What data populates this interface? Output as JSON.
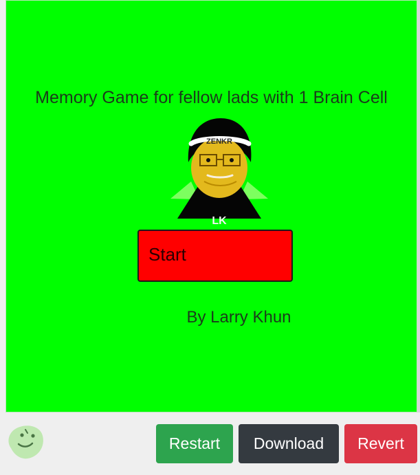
{
  "game": {
    "title": "Memory Game for fellow lads with 1 Brain Cell",
    "avatar": {
      "initials": "LK",
      "headband_text": "ZENKR"
    },
    "start_button": {
      "label": "Start"
    },
    "byline": "By Larry Khun"
  },
  "controls": {
    "restart_label": "Restart",
    "download_label": "Download",
    "revert_label": "Revert"
  },
  "icons": {
    "mascot": "green-blob-mascot-icon"
  },
  "colors": {
    "game_background": "#00ff00",
    "start_button": "#ff0000",
    "restart_button": "#2da44e",
    "download_button": "#343a40",
    "revert_button": "#dc3545"
  }
}
